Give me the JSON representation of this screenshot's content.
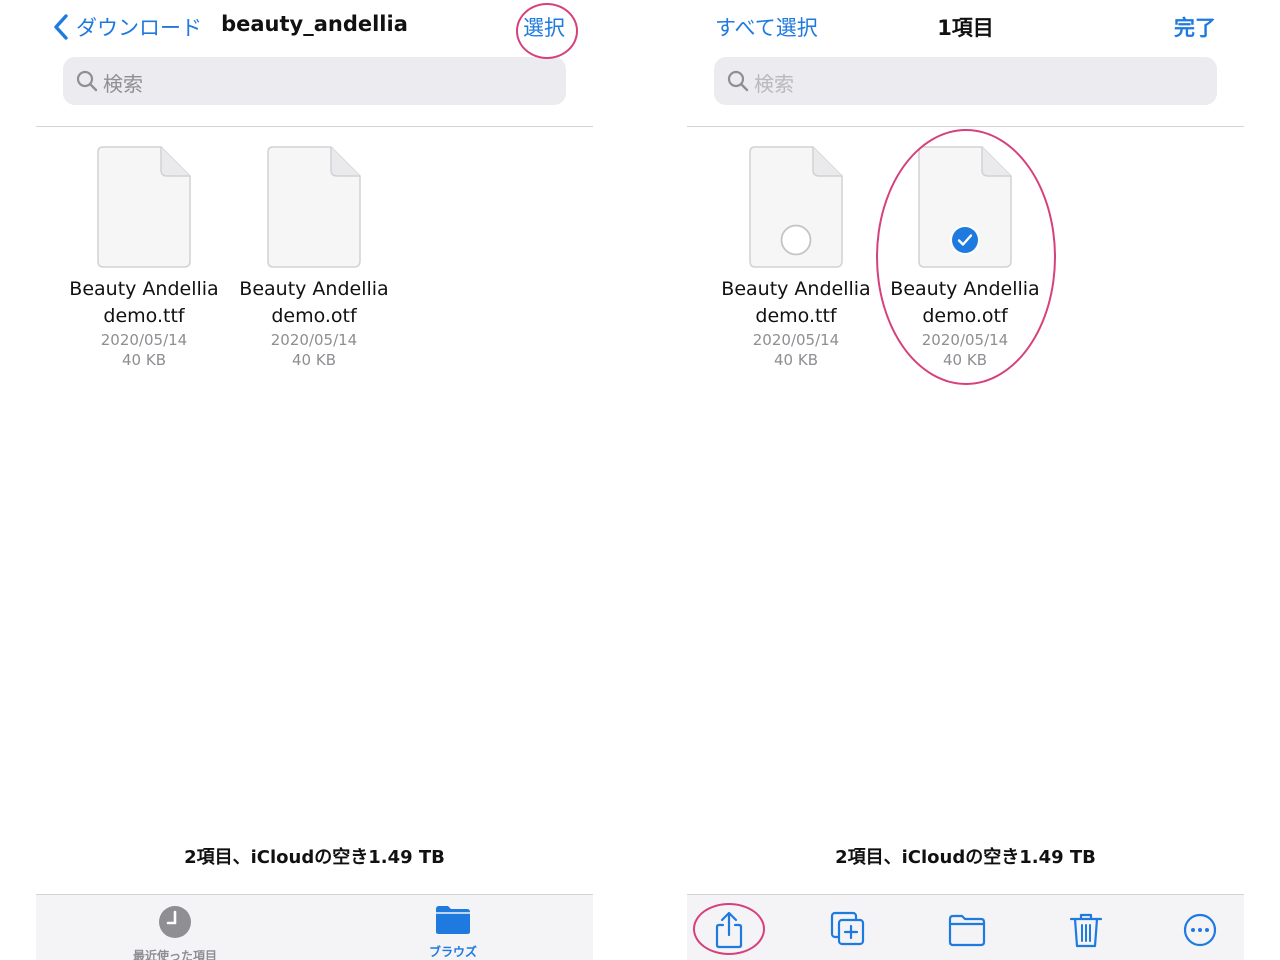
{
  "left": {
    "back_label": "ダウンロード",
    "title": "beauty_andellia",
    "select_label": "選択",
    "search_placeholder": "検索",
    "files": [
      {
        "name_line1": "Beauty Andellia",
        "name_line2": "demo.ttf",
        "date": "2020/05/14",
        "size": "40 KB"
      },
      {
        "name_line1": "Beauty Andellia",
        "name_line2": "demo.otf",
        "date": "2020/05/14",
        "size": "40 KB"
      }
    ],
    "footer": "2項目、iCloudの空き1.49 TB",
    "tabs": [
      {
        "label": "最近使った項目",
        "icon": "clock-icon"
      },
      {
        "label": "ブラウズ",
        "icon": "folder-icon"
      }
    ]
  },
  "right": {
    "select_all_label": "すべて選択",
    "title": "1項目",
    "done_label": "完了",
    "search_placeholder": "検索",
    "files": [
      {
        "name_line1": "Beauty Andellia",
        "name_line2": "demo.ttf",
        "date": "2020/05/14",
        "size": "40 KB",
        "selected": false
      },
      {
        "name_line1": "Beauty Andellia",
        "name_line2": "demo.otf",
        "date": "2020/05/14",
        "size": "40 KB",
        "selected": true
      }
    ],
    "footer": "2項目、iCloudの空き1.49 TB",
    "toolbar": [
      "share-icon",
      "duplicate-icon",
      "folder-icon",
      "trash-icon",
      "more-icon"
    ]
  },
  "colors": {
    "accent": "#1f7ae0",
    "annotation": "#d6407c",
    "inactive_tab": "#8e8e93"
  }
}
